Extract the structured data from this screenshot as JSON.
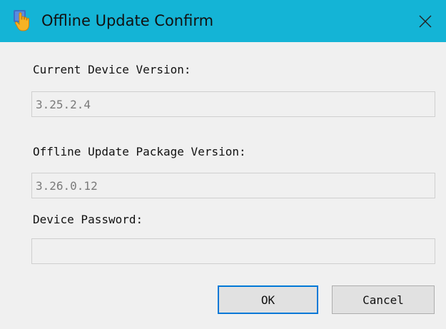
{
  "window": {
    "title": "Offline Update Confirm",
    "titlebar_color": "#14b4d6",
    "app_icon": "hand-pointer-icon",
    "close_icon": "close-icon"
  },
  "fields": {
    "current_version": {
      "label": "Current Device Version:",
      "value": "3.25.2.4"
    },
    "package_version": {
      "label": "Offline Update Package Version:",
      "value": "3.26.0.12"
    },
    "password": {
      "label": "Device Password:",
      "value": ""
    }
  },
  "buttons": {
    "ok": "OK",
    "cancel": "Cancel",
    "default_border_color": "#0078d7"
  }
}
